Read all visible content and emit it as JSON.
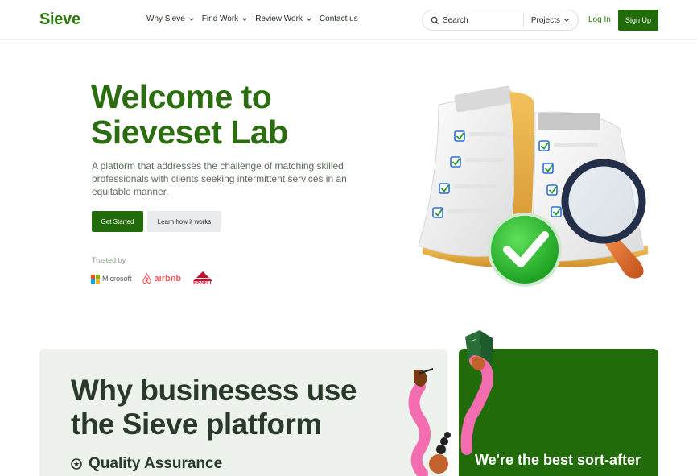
{
  "nav": {
    "logo": "Sieve",
    "menu": [
      {
        "label": "Why Sieve",
        "has_dropdown": true
      },
      {
        "label": "Find Work",
        "has_dropdown": true
      },
      {
        "label": "Review Work",
        "has_dropdown": true
      },
      {
        "label": "Contact us",
        "has_dropdown": false
      }
    ],
    "search_placeholder": "Search",
    "search_scope": "Projects",
    "login_label": "Log In",
    "signup_label": "Sign Up"
  },
  "hero": {
    "title_line1": "Welcome to",
    "title_line2": "Sieveset Lab",
    "subtitle": "A platform that addresses the challenge of matching skilled professionals with clients seeking intermittent services in an equitable manner.",
    "primary_cta": "Get Started",
    "secondary_cta": "Learn how it works",
    "trusted_by_label": "Trusted by",
    "trusted_logos": [
      "Microsoft",
      "airbnb",
      "BISSELL"
    ]
  },
  "section": {
    "title_line1": "Why businesess use",
    "title_line2": "the Sieve platform",
    "feature_1": "Quality Assurance",
    "card_text": "We're the best sort-after"
  },
  "colors": {
    "brand_green": "#226b0a",
    "title_green": "#2b6d10",
    "section_bg": "#eef2ec"
  }
}
